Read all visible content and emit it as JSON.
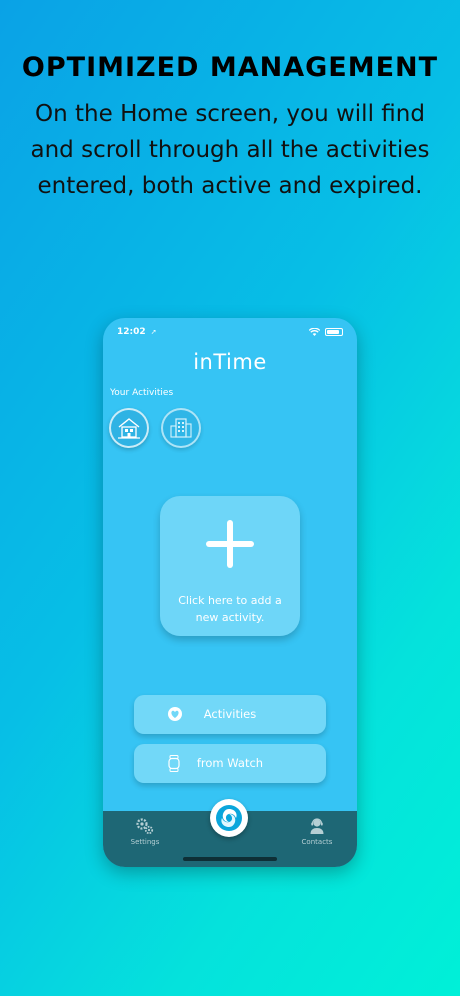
{
  "promo": {
    "headline": "OPTIMIZED MANAGEMENT",
    "subtext": "On the Home screen, you will find and scroll through all the activities entered, both active and expired."
  },
  "phone": {
    "status": {
      "time": "12:02",
      "location_icon": "location-arrow-icon",
      "wifi_icon": "wifi-icon",
      "battery_icon": "battery-icon"
    },
    "app_title": "inTime",
    "activities_section": {
      "label": "Your Activities",
      "items": [
        {
          "icon": "house-icon"
        },
        {
          "icon": "building-icon"
        }
      ]
    },
    "add_card": {
      "icon": "plus-icon",
      "text": "Click here to add a new activity."
    },
    "buttons": [
      {
        "label": "Activities",
        "icon": "heart-circle-icon"
      },
      {
        "label": "from Watch",
        "icon": "watch-icon"
      }
    ],
    "tabbar": {
      "settings": {
        "label": "Settings",
        "icon": "gears-icon"
      },
      "center": {
        "icon": "logo-swirl-icon"
      },
      "contacts": {
        "label": "Contacts",
        "icon": "support-agent-icon"
      }
    }
  },
  "colors": {
    "background_start": "#0aa2e6",
    "background_end": "#00f0d8",
    "app_bg": "#36c4f4",
    "card": "#6ed6f8",
    "tabbar": "#1e6775"
  }
}
